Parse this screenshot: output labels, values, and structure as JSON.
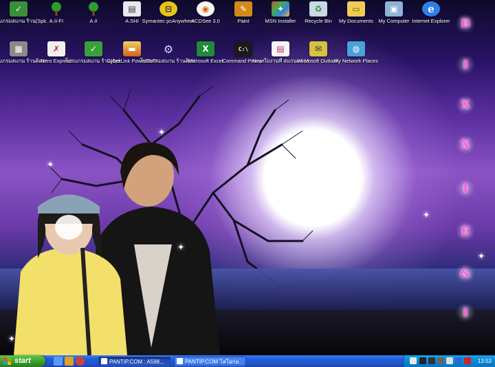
{
  "desktop": {
    "row1": [
      {
        "label": "โปรแกรมสแกน ร้าน(SplusBack)",
        "icon": "scanner-icon",
        "color": "#3a8f3a"
      },
      {
        "label": "A.II-FI",
        "icon": "tree-icon",
        "color": "#2c9c2c"
      },
      {
        "label": "A.II",
        "icon": "tree-icon",
        "color": "#2c9c2c"
      },
      {
        "label": "A.SHI",
        "icon": "window-icon",
        "color": "#6a6a90"
      },
      {
        "label": "Symantec pcAnywhere",
        "icon": "pcanywhere-icon",
        "color": "#e8c31a"
      },
      {
        "label": "ACDSee 3.0",
        "icon": "acdsee-icon",
        "color": "#e06010"
      },
      {
        "label": "Paint",
        "icon": "paint-icon",
        "color": "#d08a1a"
      },
      {
        "label": "MSN Installer",
        "icon": "msn-icon",
        "color": "#3aa0e0"
      },
      {
        "label": "Recycle Bin",
        "icon": "recycle-bin-icon",
        "color": "#9fb7c9"
      },
      {
        "label": "My Documents",
        "icon": "folder-icon",
        "color": "#f0cc55"
      },
      {
        "label": "My Computer",
        "icon": "computer-icon",
        "color": "#8fb2d8"
      },
      {
        "label": "Internet Explorer",
        "icon": "internet-explorer-icon",
        "color": "#2f7fe6"
      }
    ],
    "row2": [
      {
        "label": "โปรแกรมสแกน ร้านติดตาม...",
        "icon": "scanner-icon",
        "color": "#6f6f6f"
      },
      {
        "label": "Nero Express",
        "icon": "nero-icon",
        "color": "#c62020"
      },
      {
        "label": "โปรแกรมสแกน ร้าน(SplusP...",
        "icon": "scanner-icon",
        "color": "#3aa03a"
      },
      {
        "label": "CyberLink PowerDVD",
        "icon": "powerdvd-icon",
        "color": "#e0a020"
      },
      {
        "label": "โปรแกรมสแกน ร้านติดตาม...",
        "icon": "gear-icon",
        "color": "#6a7ec0"
      },
      {
        "label": "Microsoft Excel",
        "icon": "excel-icon",
        "color": "#1f8a3a"
      },
      {
        "label": "Command Prompt",
        "icon": "command-prompt-icon",
        "color": "#1a1a1a"
      },
      {
        "label": "New ใบงานที่ สแกนผล ML...",
        "icon": "document-icon",
        "color": "#c02a6a"
      },
      {
        "label": "Microsoft Outlook",
        "icon": "outlook-icon",
        "color": "#d8c040"
      },
      {
        "label": "My Network Places",
        "icon": "network-icon",
        "color": "#4aa0d8"
      }
    ],
    "decoration_letters": [
      "B",
      "I",
      "X",
      "X",
      "I",
      "E",
      "&",
      "I"
    ]
  },
  "taskbar": {
    "start_label": "start",
    "tasks": [
      {
        "label": "PANTIP.COM : A598...",
        "active": true
      },
      {
        "label": "PANTIP.COM โลโอก่อ...",
        "active": false
      }
    ],
    "clock": "13:53"
  },
  "colors": {
    "taskbar": "#245edc",
    "start": "#379b26",
    "tray": "#0d8ad6",
    "deco": "#ff5bd9"
  }
}
